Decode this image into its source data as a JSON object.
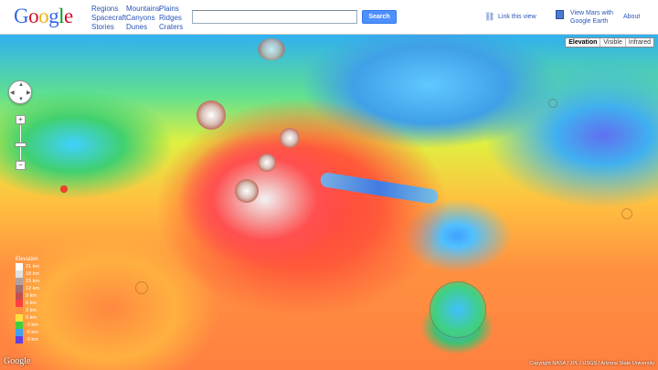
{
  "header": {
    "logo": [
      "G",
      "o",
      "o",
      "g",
      "l",
      "e"
    ],
    "logo_colors": [
      "#3369e8",
      "#d50f25",
      "#eeb211",
      "#3369e8",
      "#009925",
      "#d50f25"
    ],
    "nav": [
      [
        "Regions",
        "Spacecraft",
        "Stories"
      ],
      [
        "Mountains",
        "Canyons",
        "Dunes"
      ],
      [
        "Plains",
        "Ridges",
        "Craters"
      ]
    ],
    "search_value": "",
    "search_button": "Search",
    "link_view": "Link this view",
    "view_earth_line1": "View Mars with",
    "view_earth_line2": "Google Earth",
    "about": "About"
  },
  "map_types": [
    "Elevation",
    "Visible",
    "Infrared"
  ],
  "legend": {
    "title": "Elevation",
    "items": [
      {
        "label": "21 km",
        "color": "#ffffff"
      },
      {
        "label": "18 km",
        "color": "#e0e0e0"
      },
      {
        "label": "15 km",
        "color": "#b0a0a0"
      },
      {
        "label": "12 km",
        "color": "#a07070"
      },
      {
        "label": "9 km",
        "color": "#c05050"
      },
      {
        "label": "6 km",
        "color": "#ff4040"
      },
      {
        "label": "3 km",
        "color": "#ff9040"
      },
      {
        "label": "0 km",
        "color": "#ffe040"
      },
      {
        "label": "-3 km",
        "color": "#40d040"
      },
      {
        "label": "-6 km",
        "color": "#40a0ff"
      },
      {
        "label": "-9 km",
        "color": "#6040e0"
      }
    ]
  },
  "watermark": "Google",
  "copyright": "Copyright NASA / JPL / USGS / Arizona State University"
}
